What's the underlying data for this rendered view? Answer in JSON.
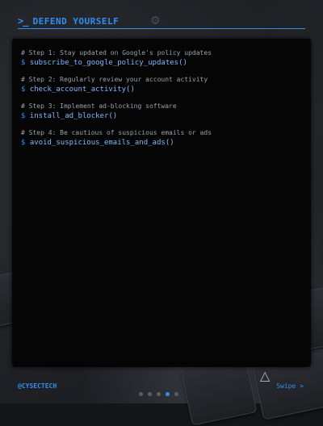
{
  "header": {
    "prompt_icon": ">_",
    "title": "DEFEND YOURSELF"
  },
  "terminal": {
    "steps": [
      {
        "comment": "# Step 1: Stay updated on Google's policy updates",
        "prompt": "$",
        "command": "subscribe_to_google_policy_updates()"
      },
      {
        "comment": "# Step 2: Regularly review your account activity",
        "prompt": "$",
        "command": "check_account_activity()"
      },
      {
        "comment": "# Step 3: Implement ad-blocking software",
        "prompt": "$",
        "command": "install_ad_blocker()"
      },
      {
        "comment": "# Step 4: Be cautious of suspicious emails or ads",
        "prompt": "$",
        "command": "avoid_suspicious_emails_and_ads()"
      }
    ]
  },
  "footer": {
    "handle": "@CYSECTECH",
    "swipe_label": "Swipe >",
    "pagination": {
      "total": 5,
      "active": 4
    }
  },
  "colors": {
    "accent": "#2f8ff3",
    "terminal_bg": "#050505",
    "comment_text": "#9ba1aa"
  },
  "icons": {
    "prompt": "terminal-prompt-icon",
    "background_gear": "gear-icon",
    "background_triangle": "triangle-key-icon"
  }
}
